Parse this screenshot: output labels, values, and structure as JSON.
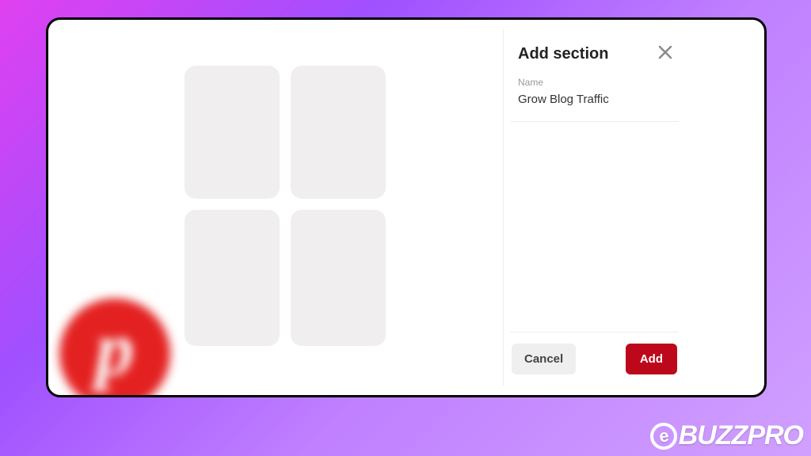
{
  "modal": {
    "title": "Add section",
    "name_label": "Name",
    "name_value": "Grow Blog Traffic",
    "cancel_label": "Cancel",
    "add_label": "Add"
  },
  "brand": {
    "pinterest_glyph": "p"
  },
  "watermark": {
    "text": "BUZZPRO",
    "e": "e"
  }
}
